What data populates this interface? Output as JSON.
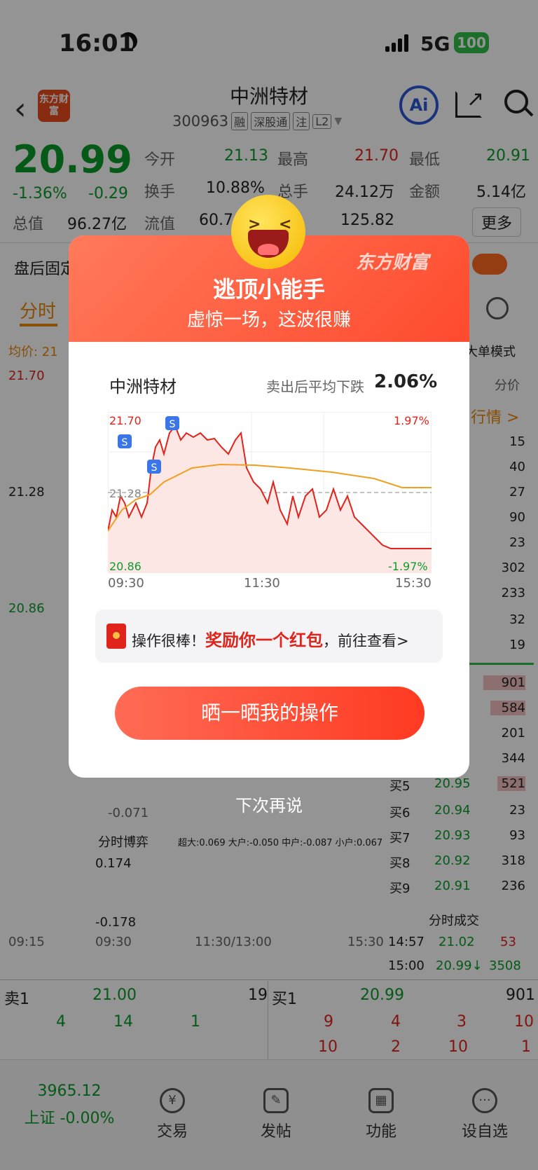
{
  "status": {
    "time": "16:01",
    "network": "5G",
    "battery": "100"
  },
  "header": {
    "back": "‹",
    "logo": "东方财富",
    "title": "中洲特材",
    "code": "300963",
    "tags": [
      "融",
      "深股通",
      "注",
      "L2"
    ],
    "ai_label": "Ai"
  },
  "quote": {
    "price": "20.99",
    "change_pct": "-1.36%",
    "change": "-0.29",
    "open_label": "今开",
    "open": "21.13",
    "high_label": "最高",
    "high": "21.70",
    "low_label": "最低",
    "low": "20.91",
    "turnover_label": "换手",
    "turnover": "10.88%",
    "volume_label": "总手",
    "volume": "24.12万",
    "amount_label": "金额",
    "amount": "5.14亿",
    "mcap_label": "总值",
    "mcap": "96.27亿",
    "float_label": "流值",
    "float": "60.7",
    "pe": "125.82",
    "more": "更多"
  },
  "background": {
    "fixed_label": "盘后固定",
    "tab_intraday": "分时",
    "avg_label": "均价: 21",
    "big_order": "大单模式",
    "price_col": "分价",
    "hq_link": "行情 >",
    "y_high": "21.70",
    "y_mid": "21.28",
    "y_low": "20.86",
    "neg_val": "-0.071",
    "game_label": "分时博弈",
    "game_legend": "超大:0.069 大户:-0.050 中户:-0.087 小户:0.067",
    "game_top": "0.174",
    "game_bottom": "-0.178",
    "x_labels": [
      "09:15",
      "09:30",
      "11:30/13:00",
      "15:30"
    ],
    "vol_col": [
      "15",
      "40",
      "27",
      "90",
      "23",
      "302",
      "233",
      "32",
      "19",
      "901",
      "584",
      "201",
      "344",
      "521"
    ],
    "buys": [
      {
        "label": "买5",
        "price": "20.95",
        "vol": "521"
      },
      {
        "label": "买6",
        "price": "20.94",
        "vol": "23"
      },
      {
        "label": "买7",
        "price": "20.93",
        "vol": "93"
      },
      {
        "label": "买8",
        "price": "20.92",
        "vol": "318"
      },
      {
        "label": "买9",
        "price": "20.91",
        "vol": "236"
      }
    ],
    "ticks_title": "分时成交",
    "ticks": [
      {
        "time": "14:57",
        "price": "21.02",
        "vol": "53"
      },
      {
        "time": "15:00",
        "price": "20.99↓",
        "vol": "3508"
      }
    ],
    "sell1_label": "卖1",
    "sell1_price": "21.00",
    "sell1_vol": "19",
    "buy1_label": "买1",
    "buy1_price": "20.99",
    "buy1_vol": "901",
    "sell_queue": [
      "4",
      "14",
      "1"
    ],
    "buy_queue_1": [
      "9",
      "4",
      "3",
      "10"
    ],
    "buy_queue_2": [
      "10",
      "2",
      "10",
      "1"
    ]
  },
  "popup": {
    "brand": "东方财富",
    "title": "逃顶小能手",
    "subtitle": "虚惊一场，这波很赚",
    "stock_name": "中洲特材",
    "drop_label": "卖出后平均下跌",
    "drop_value": "2.06%",
    "chart_high": "21.70",
    "chart_mid": "21.28",
    "chart_low": "20.86",
    "chart_high_pct": "1.97%",
    "chart_low_pct": "-1.97%",
    "chart_times": [
      "09:30",
      "11:30",
      "15:30"
    ],
    "sell_marker": "S",
    "reward_prefix": "操作很棒！",
    "reward_highlight": "奖励你一个红包",
    "reward_suffix": "，前往查看>",
    "share_button": "晒一晒我的操作",
    "later": "下次再说"
  },
  "bottom_nav": {
    "index_value": "3965.12",
    "index_label": "上证 -0.00%",
    "items": [
      "交易",
      "发帖",
      "功能",
      "设自选"
    ]
  },
  "chart_data": {
    "type": "line",
    "x": [
      "09:30",
      "11:30",
      "15:30"
    ],
    "ylim": [
      20.86,
      21.7
    ],
    "series": []
  }
}
